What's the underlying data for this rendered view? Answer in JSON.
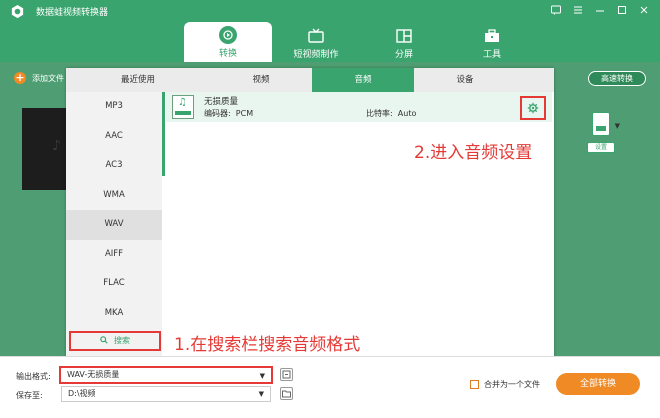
{
  "app": {
    "title": "数据蛙视频转换器"
  },
  "window_controls": [
    "message-icon",
    "menu-icon",
    "minimize-icon",
    "maximize-icon",
    "close-icon"
  ],
  "nav": {
    "tabs": [
      {
        "label": "转换",
        "icon": "convert-icon",
        "active": true
      },
      {
        "label": "短视频制作",
        "icon": "tv-icon",
        "active": false
      },
      {
        "label": "分屏",
        "icon": "split-icon",
        "active": false
      },
      {
        "label": "工具",
        "icon": "toolbox-icon",
        "active": false
      }
    ]
  },
  "toolbar": {
    "add_file": "添加文件",
    "turbo": "高速转换"
  },
  "format_panel": {
    "tabs": [
      {
        "label": "最近使用",
        "active": false
      },
      {
        "label": "视频",
        "active": false
      },
      {
        "label": "音频",
        "active": true
      },
      {
        "label": "设备",
        "active": false
      }
    ],
    "formats": [
      "MP3",
      "AAC",
      "AC3",
      "WMA",
      "WAV",
      "AIFF",
      "FLAC",
      "MKA"
    ],
    "selected_format": "WAV",
    "search_label": "搜索",
    "preset": {
      "name": "无损质量",
      "encoder_label": "编码器:",
      "encoder_value": "PCM",
      "bitrate_label": "比特率:",
      "bitrate_value": "Auto"
    }
  },
  "output_card": {
    "settings_label": "设置"
  },
  "annotations": {
    "step1": "1.在搜索栏搜索音频格式",
    "step2": "2.进入音频设置"
  },
  "bottom": {
    "output_format_label": "输出格式:",
    "output_format_value": "WAV-无损质量",
    "save_to_label": "保存至:",
    "save_to_value": "D:\\视频",
    "merge_label": "合并为一个文件",
    "convert_all": "全部转换"
  },
  "colors": {
    "accent": "#3aa46f",
    "orange": "#f08a24",
    "highlight": "#e53935"
  }
}
